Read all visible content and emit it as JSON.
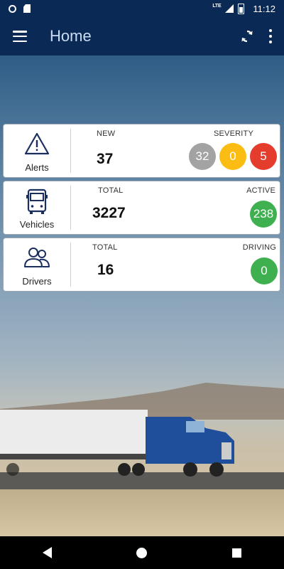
{
  "status_bar": {
    "time": "11:12",
    "network": "LTE"
  },
  "app_bar": {
    "title": "Home"
  },
  "colors": {
    "app_bar": "#0a2a55",
    "severity_low": "#a3a3a3",
    "severity_medium": "#fbbd14",
    "severity_high": "#e53d2d",
    "active_green": "#3fb04f"
  },
  "cards": {
    "alerts": {
      "label": "Alerts",
      "icon": "warning-triangle-icon",
      "new_caption": "NEW",
      "new_value": "37",
      "severity_caption": "SEVERITY",
      "severity": [
        "32",
        "0",
        "5"
      ]
    },
    "vehicles": {
      "label": "Vehicles",
      "icon": "truck-icon",
      "total_caption": "TOTAL",
      "total_value": "3227",
      "active_caption": "ACTIVE",
      "active_value": "238"
    },
    "drivers": {
      "label": "Drivers",
      "icon": "people-icon",
      "total_caption": "TOTAL",
      "total_value": "16",
      "driving_caption": "DRIVING",
      "driving_value": "0"
    }
  }
}
